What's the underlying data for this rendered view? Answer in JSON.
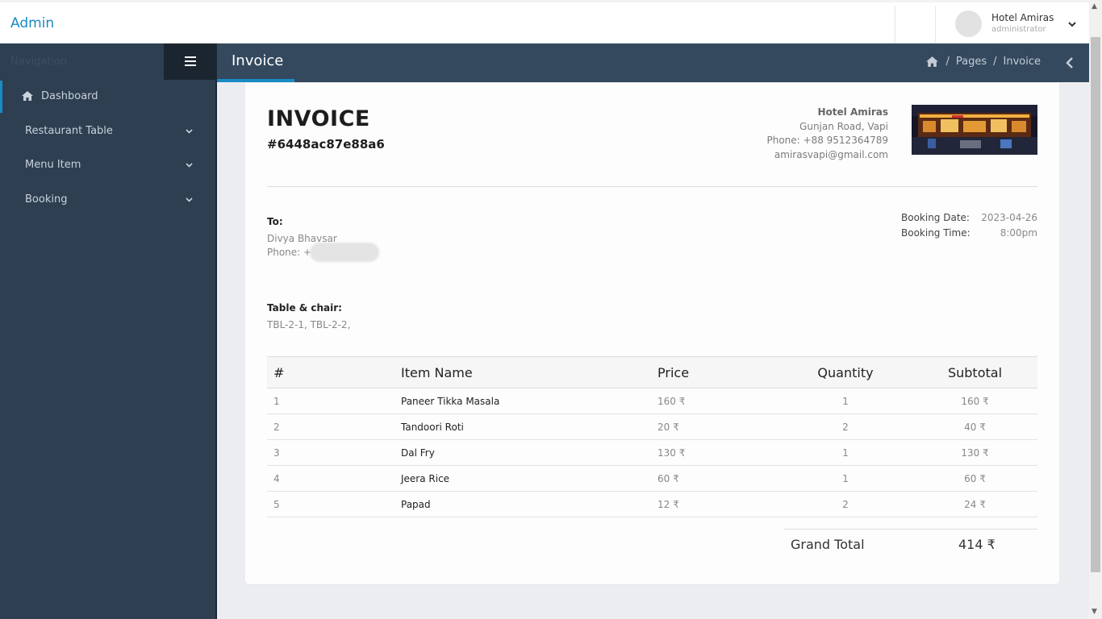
{
  "brand": "Admin",
  "user": {
    "name": "Hotel Amiras",
    "role": "administrator"
  },
  "sidebar": {
    "nav_title": "Navigation",
    "items": [
      {
        "label": "Dashboard",
        "icon": "home-icon",
        "active": true
      },
      {
        "label": "Restaurant Table",
        "icon": "chevron-down-icon"
      },
      {
        "label": "Menu Item",
        "icon": "chevron-down-icon"
      },
      {
        "label": "Booking",
        "icon": "chevron-down-icon"
      }
    ]
  },
  "header": {
    "title": "Invoice",
    "breadcrumb": [
      "Pages",
      "Invoice"
    ]
  },
  "invoice": {
    "title": "INVOICE",
    "number": "#6448ac87e88a6",
    "hotel": {
      "name": "Hotel Amiras",
      "address": "Gunjan Road, Vapi",
      "phone": "Phone: +88 9512364789",
      "email": "amirasvapi@gmail.com"
    },
    "to": {
      "label": "To:",
      "name": "Divya Bhavsar",
      "phone": "Phone: +9"
    },
    "booking": {
      "date_label": "Booking Date:",
      "date_value": "2023-04-26",
      "time_label": "Booking Time:",
      "time_value": "8:00pm"
    },
    "tables": {
      "label": "Table & chair:",
      "value": "TBL-2-1, TBL-2-2,"
    },
    "columns": [
      "#",
      "Item Name",
      "Price",
      "Quantity",
      "Subtotal"
    ],
    "items": [
      {
        "num": "1",
        "name": "Paneer Tikka Masala",
        "price": "160 ₹",
        "qty": "1",
        "subtotal": "160 ₹"
      },
      {
        "num": "2",
        "name": "Tandoori Roti",
        "price": "20 ₹",
        "qty": "2",
        "subtotal": "40 ₹"
      },
      {
        "num": "3",
        "name": "Dal Fry",
        "price": "130 ₹",
        "qty": "1",
        "subtotal": "130 ₹"
      },
      {
        "num": "4",
        "name": "Jeera Rice",
        "price": "60 ₹",
        "qty": "1",
        "subtotal": "60 ₹"
      },
      {
        "num": "5",
        "name": "Papad",
        "price": "12 ₹",
        "qty": "2",
        "subtotal": "24 ₹"
      }
    ],
    "grand_total_label": "Grand Total",
    "grand_total_value": "414 ₹"
  },
  "colors": {
    "brand": "#1a8bc5",
    "sidebar": "#2e3f51",
    "header": "#34495e"
  }
}
